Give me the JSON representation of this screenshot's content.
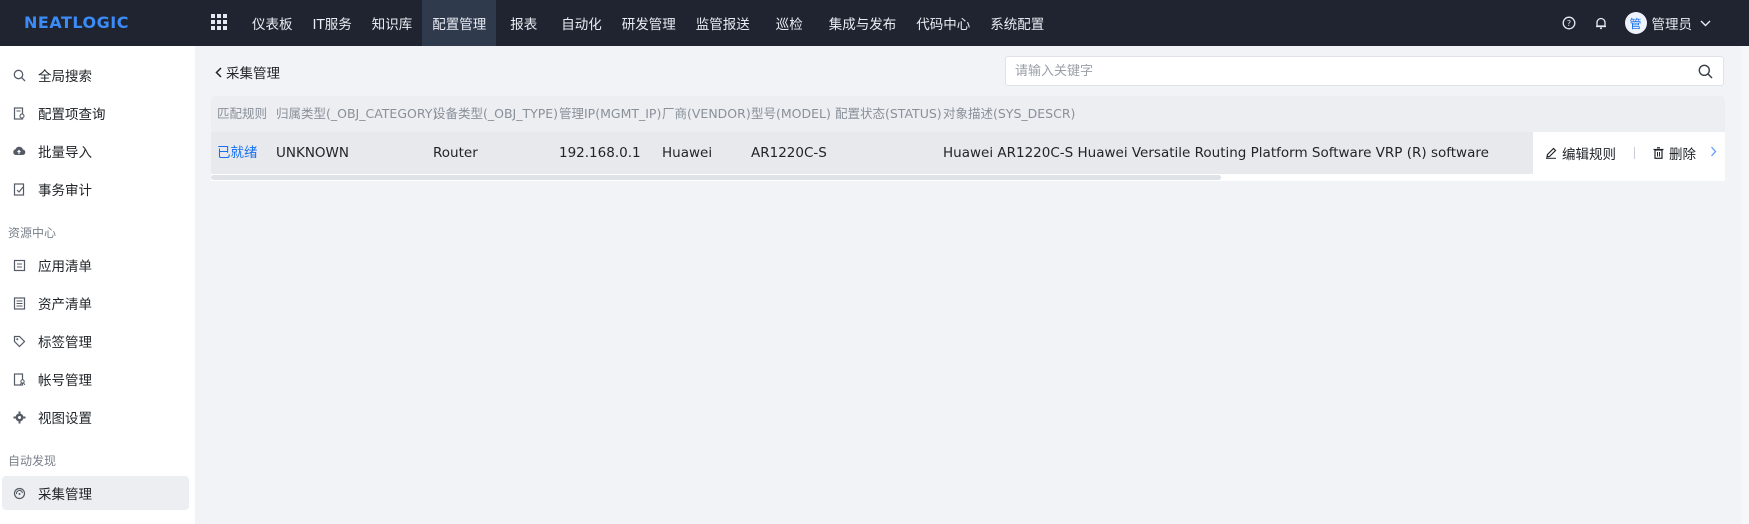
{
  "app": {
    "logo_text": "NEATLOGIC"
  },
  "topnav": {
    "items": [
      {
        "label": "仪表板"
      },
      {
        "label": "IT服务"
      },
      {
        "label": "知识库"
      },
      {
        "label": "配置管理",
        "active": true
      },
      {
        "label": "报表"
      },
      {
        "label": "自动化"
      },
      {
        "label": "研发管理"
      },
      {
        "label": "监管报送"
      },
      {
        "label": "巡检"
      },
      {
        "label": "集成与发布"
      },
      {
        "label": "代码中心"
      },
      {
        "label": "系统配置"
      }
    ],
    "help_icon": "help-circle-icon",
    "bell_icon": "bell-icon",
    "avatar_text": "管",
    "username": "管理员"
  },
  "sidebar": {
    "items": [
      {
        "label": "全局搜索",
        "icon": "search-icon"
      },
      {
        "label": "配置项查询",
        "icon": "document-search-icon"
      },
      {
        "label": "批量导入",
        "icon": "cloud-upload-icon"
      },
      {
        "label": "事务审计",
        "icon": "audit-icon"
      }
    ],
    "group_resource": "资源中心",
    "resource_items": [
      {
        "label": "应用清单",
        "icon": "app-list-icon"
      },
      {
        "label": "资产清单",
        "icon": "asset-list-icon"
      },
      {
        "label": "标签管理",
        "icon": "tag-icon"
      },
      {
        "label": "帐号管理",
        "icon": "account-icon"
      },
      {
        "label": "视图设置",
        "icon": "gear-icon"
      }
    ],
    "group_discovery": "自动发现",
    "discovery_items": [
      {
        "label": "采集管理",
        "icon": "collect-icon",
        "active": true
      }
    ]
  },
  "main": {
    "back_label": "采集管理",
    "search_placeholder": "请输入关键字",
    "columns": [
      "匹配规则",
      "归属类型(_OBJ_CATEGORY)",
      "设备类型(_OBJ_TYPE)",
      "管理IP(MGMT_IP)",
      "厂商(VENDOR)",
      "型号(MODEL)",
      "配置状态(STATUS)",
      "对象描述(SYS_DESCR)"
    ],
    "rows": [
      {
        "match_rule": "已就绪",
        "obj_category": "UNKNOWN",
        "obj_type": "Router",
        "mgmt_ip": "192.168.0.1",
        "vendor": "Huawei",
        "model": "AR1220C-S",
        "status": "",
        "sys_descr": "Huawei AR1220C-S Huawei Versatile Routing Platform Software VRP (R) software"
      }
    ],
    "actions": {
      "edit_label": "编辑规则",
      "delete_label": "删除"
    }
  },
  "colors": {
    "topbar_bg": "#1f2430",
    "accent": "#1670f0",
    "page_bg": "#f2f3f7"
  }
}
